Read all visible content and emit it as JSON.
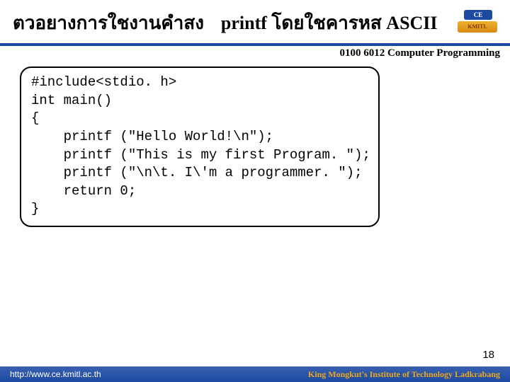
{
  "header": {
    "title_left": "ตวอยางการใชงานคำสง",
    "title_right": "printf โดยใชคารหส  ASCII"
  },
  "logo": {
    "top_text": "CE",
    "bottom_text": "KMITL"
  },
  "course_label": "0100 6012 Computer Programming",
  "code_lines": [
    "#include<stdio. h>",
    "int main()",
    "{",
    "    printf (\"Hello World!\\n\");",
    "    printf (\"This is my first Program. \");",
    "    printf (\"\\n\\t. I\\'m a programmer. \");",
    "    return 0;",
    "}"
  ],
  "page_number": "18",
  "footer": {
    "url": "http://www.ce.kmitl.ac.th",
    "institution": "King Mongkut's Institute of Technology Ladkrabang"
  }
}
